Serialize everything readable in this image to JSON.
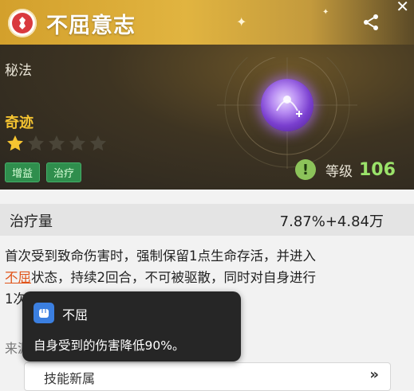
{
  "header": {
    "title": "不屈意志",
    "category": "秘法",
    "rarity": "奇迹",
    "stars": {
      "filled": 1,
      "total": 5
    },
    "tags": [
      "增益",
      "治疗"
    ],
    "level_label": "等级",
    "level_value": "106"
  },
  "stat": {
    "label": "治疗量",
    "value": "7.87%+4.84万"
  },
  "description": {
    "line1": "首次受到致命伤害时，强制保留1点生命存活，并进入",
    "keyword": "不屈",
    "line2": "状态，持续2回合，不可被驱散，同时对自身进行",
    "line3": "1次"
  },
  "source_label": "来源",
  "bottom_button": {
    "label": "技能新属",
    "arrows": "»"
  },
  "tooltip": {
    "title": "不屈",
    "description": "自身受到的伤害降低90%。"
  },
  "colors": {
    "title_gold": "#d3a02c",
    "tag_green": "#2f8e4d",
    "level_green": "#9be36a",
    "highlight_orange": "#e0541a",
    "orb_purple": "#7a3fcf"
  }
}
